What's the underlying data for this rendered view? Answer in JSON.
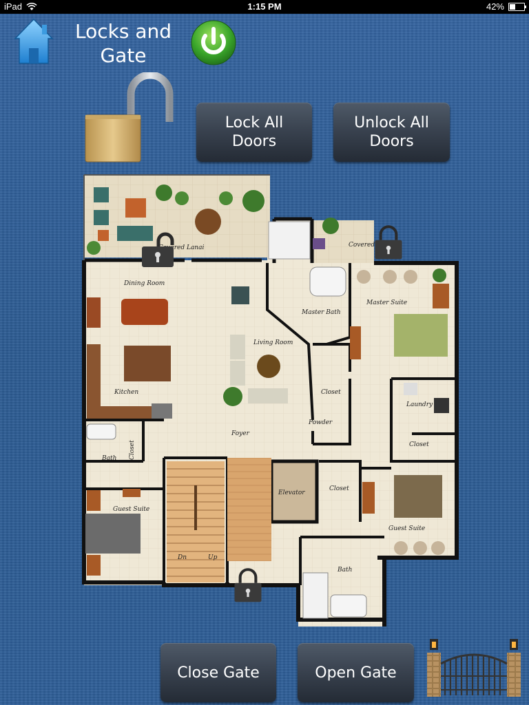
{
  "status_bar": {
    "device": "iPad",
    "time": "1:15 PM",
    "battery": "42%",
    "battery_level": 0.42
  },
  "header": {
    "title": "Locks and Gate"
  },
  "buttons": {
    "lock_all": "Lock All Doors",
    "unlock_all": "Unlock All Doors",
    "close_gate": "Close Gate",
    "open_gate": "Open Gate"
  },
  "icons": {
    "home": "home-icon",
    "power": "power-icon",
    "padlock_master": "padlock-open-icon",
    "gate": "gate-icon"
  },
  "floorplan": {
    "rooms": {
      "covered_lanai_1": "Covered Lanai",
      "covered_lanai_2": "Covered Lanai",
      "dining_room": "Dining Room",
      "master_bath": "Master Bath",
      "master_suite": "Master Suite",
      "living_room": "Living Room",
      "kitchen": "Kitchen",
      "closet_1": "Closet",
      "laundry": "Laundry",
      "powder": "Powder",
      "closet_2": "Closet",
      "foyer": "Foyer",
      "bath_1": "Bath",
      "closet_3": "Closet",
      "elevator": "Elevator",
      "closet_4": "Closet",
      "guest_suite_1": "Guest Suite",
      "guest_suite_2": "Guest Suite",
      "dn": "Dn",
      "up": "Up",
      "bath_2": "Bath"
    },
    "locks": {
      "lanai_west": "unlocked",
      "lanai_east": "locked",
      "front_door": "locked"
    }
  },
  "colors": {
    "background": "#2f5f95",
    "button_dark": "#2b323d",
    "power_green": "#3aa62b",
    "floor_tile": "#eee6d4",
    "wall": "#111111"
  }
}
